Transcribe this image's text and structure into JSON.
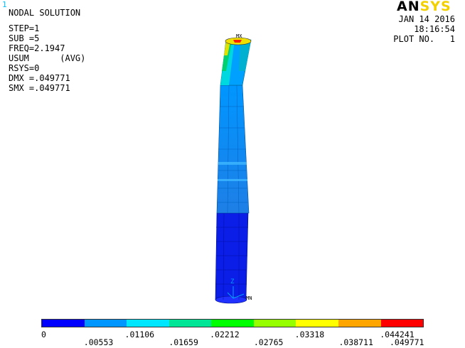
{
  "window_number": "1",
  "info": {
    "title": "NODAL SOLUTION",
    "lines": [
      "STEP=1",
      "SUB =5",
      "FREQ=2.1947",
      "USUM      (AVG)",
      "RSYS=0",
      "DMX =.049771",
      "SMX =.049771"
    ]
  },
  "header": {
    "date": "JAN 14 2016",
    "time": "18:16:54",
    "plot_no": "PLOT NO.   1"
  },
  "logo": {
    "part1": "AN",
    "part2": "SYS"
  },
  "markers": {
    "max": "MX",
    "min": "MN",
    "axis": "Z"
  },
  "legend": {
    "colors": [
      "#0000ff",
      "#0096ff",
      "#00e6ff",
      "#00e696",
      "#00ff00",
      "#96ff00",
      "#ffff00",
      "#ffa500",
      "#ff0000"
    ],
    "top_labels": [
      "0",
      ".01106",
      ".02212",
      ".03318",
      ".044241"
    ],
    "bottom_labels": [
      ".00553",
      ".01659",
      ".02765",
      ".038711",
      ".049771"
    ]
  }
}
